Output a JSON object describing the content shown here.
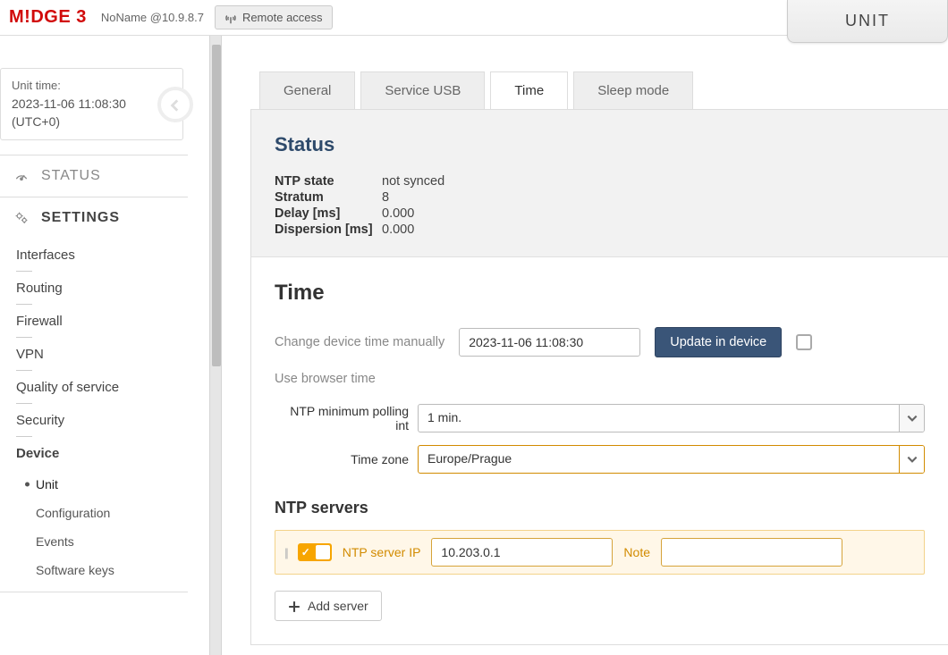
{
  "header": {
    "logo": "M!DGE 3",
    "host": "NoName @10.9.8.7",
    "remote_label": "Remote access",
    "unit_tab": "UNIT"
  },
  "time_card": {
    "label": "Unit time:",
    "value": "2023-11-06 11:08:30",
    "tz": "(UTC+0)"
  },
  "nav": {
    "status": "STATUS",
    "settings": "SETTINGS",
    "items": [
      "Interfaces",
      "Routing",
      "Firewall",
      "VPN",
      "Quality of service",
      "Security",
      "Device"
    ],
    "device_sub": [
      "Unit",
      "Configuration",
      "Events",
      "Software keys"
    ]
  },
  "tabs": [
    "General",
    "Service USB",
    "Time",
    "Sleep mode"
  ],
  "status": {
    "heading": "Status",
    "rows": [
      {
        "k": "NTP state",
        "v": "not synced"
      },
      {
        "k": "Stratum",
        "v": "8"
      },
      {
        "k": "Delay [ms]",
        "v": "0.000"
      },
      {
        "k": "Dispersion [ms]",
        "v": "0.000"
      }
    ]
  },
  "time_section": {
    "heading": "Time",
    "manual_label": "Change device time manually",
    "manual_value": "2023-11-06 11:08:30",
    "update_btn": "Update in device",
    "browser_time": "Use browser time",
    "poll_label": "NTP minimum polling int",
    "poll_value": "1 min.",
    "tz_label": "Time zone",
    "tz_value": "Europe/Prague"
  },
  "ntp": {
    "heading": "NTP servers",
    "ip_label": "NTP server IP",
    "ip_value": "10.203.0.1",
    "note_label": "Note",
    "note_value": "",
    "add_btn": "Add server"
  }
}
